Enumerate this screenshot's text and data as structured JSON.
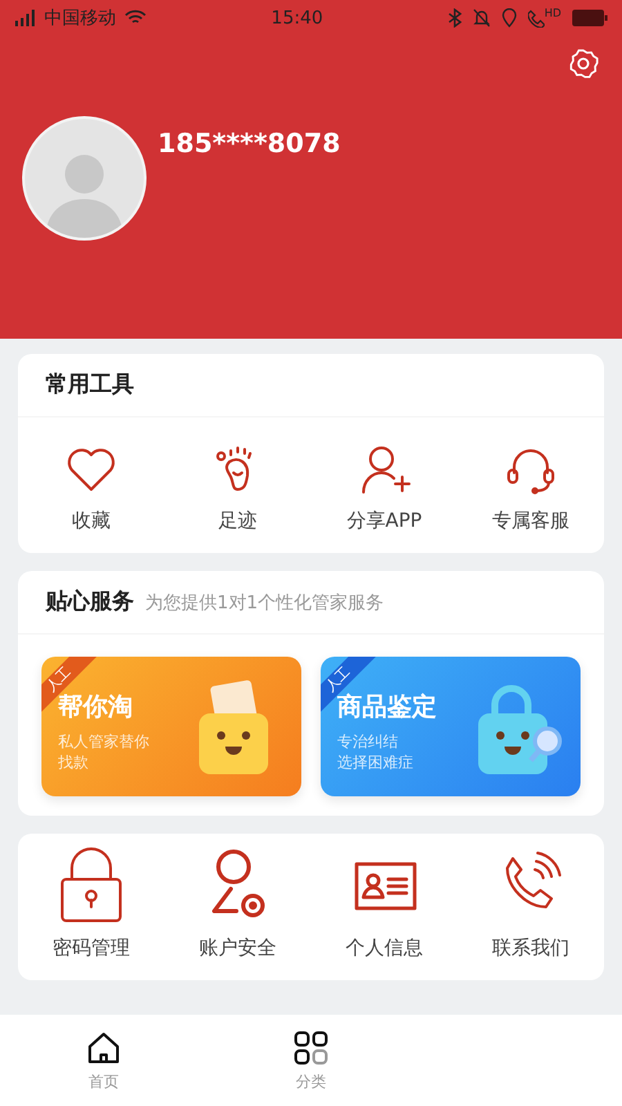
{
  "status_bar": {
    "carrier": "中国移动",
    "time": "15:40",
    "call_badge": "HD"
  },
  "profile": {
    "phone": "185****8078"
  },
  "tools": {
    "title": "常用工具",
    "items": [
      {
        "kind": "heart",
        "label": "收藏"
      },
      {
        "kind": "foot",
        "label": "足迹"
      },
      {
        "kind": "share",
        "label": "分享APP"
      },
      {
        "kind": "headset",
        "label": "专属客服"
      }
    ]
  },
  "services": {
    "title": "贴心服务",
    "subtitle": "为您提供1对1个性化管家服务",
    "cards": [
      {
        "kind": "orange",
        "ribbon": "人工",
        "title": "帮你淘",
        "desc": [
          "私人管家替你",
          "找款"
        ]
      },
      {
        "kind": "blue",
        "ribbon": "人工",
        "title": "商品鉴定",
        "desc": [
          "专治纠结",
          "选择困难症"
        ]
      }
    ]
  },
  "account": {
    "items": [
      {
        "kind": "lock",
        "label": "密码管理"
      },
      {
        "kind": "user-gear",
        "label": "账户安全"
      },
      {
        "kind": "id-card",
        "label": "个人信息"
      },
      {
        "kind": "phone",
        "label": "联系我们"
      }
    ]
  },
  "tab_bar": [
    {
      "kind": "home",
      "label": "首页",
      "selected": false
    },
    {
      "kind": "grid",
      "label": "分类",
      "selected": false
    }
  ]
}
